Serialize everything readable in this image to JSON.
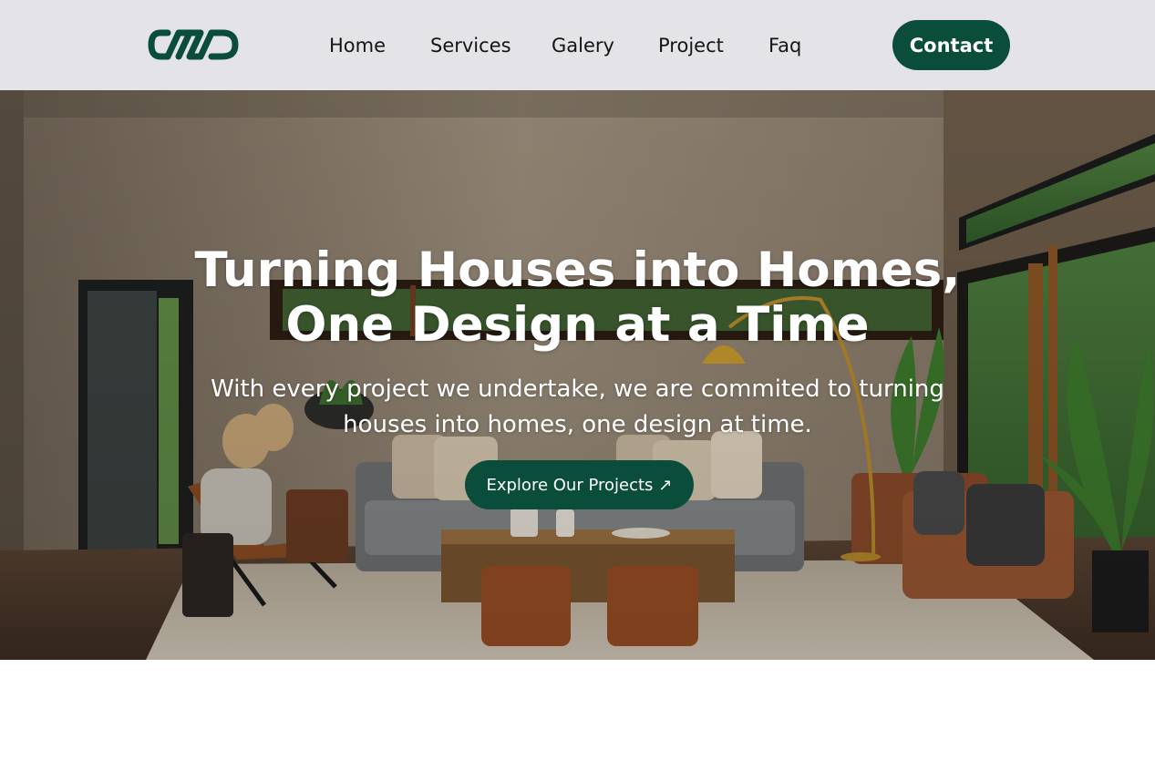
{
  "nav": {
    "logo_icon": "infinity-link-logo-icon",
    "links": [
      {
        "label": "Home"
      },
      {
        "label": "Services"
      },
      {
        "label": "Galery"
      },
      {
        "label": "Project"
      },
      {
        "label": "Faq"
      }
    ],
    "contact_label": "Contact"
  },
  "hero": {
    "title_line1": "Turning Houses into Homes,",
    "title_line2": "One Design at a Time",
    "subtitle_line1": "With every project we undertake, we are commited to turning",
    "subtitle_line2": "houses into homes, one design at time.",
    "cta_label": "Explore Our Projects",
    "cta_icon": "arrow-up-right-icon",
    "cta_glyph": "↗",
    "background_image": "living-room-interior-photo"
  },
  "colors": {
    "brand": "#0b4d3b",
    "nav_bg": "#e4e3e8",
    "nav_text": "#141414"
  }
}
